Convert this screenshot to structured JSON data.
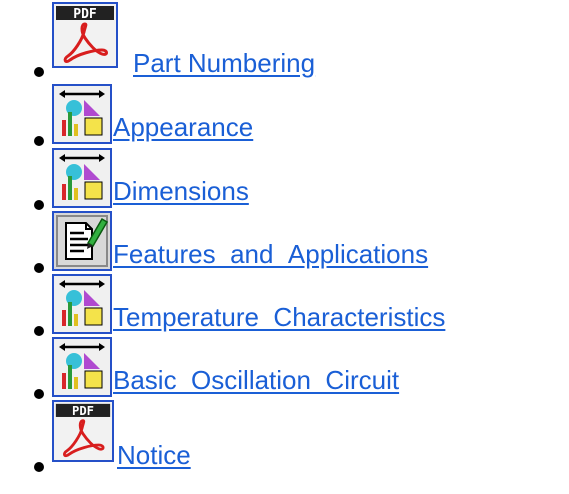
{
  "links": [
    {
      "label": "Part Numbering",
      "icon": "pdf-icon"
    },
    {
      "label": "Appearance",
      "icon": "chart-image-icon"
    },
    {
      "label": "Dimensions",
      "icon": "chart-image-icon"
    },
    {
      "label": "Features_and_Applications",
      "icon": "document-edit-icon"
    },
    {
      "label": "Temperature_Characteristics",
      "icon": "chart-image-icon"
    },
    {
      "label": "Basic_Oscillation_Circuit",
      "icon": "chart-image-icon"
    },
    {
      "label": "Notice",
      "icon": "pdf-icon"
    }
  ],
  "colors": {
    "link": "#1a5fd6",
    "icon_border": "#2550c8"
  }
}
